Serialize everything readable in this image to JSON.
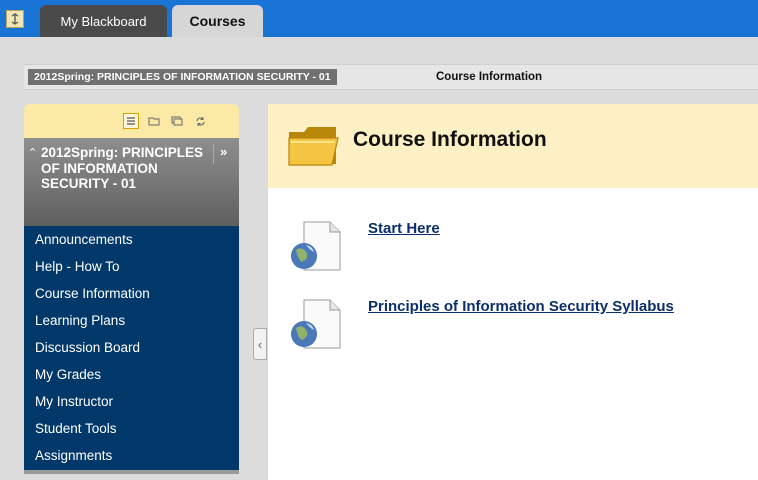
{
  "tabs": [
    {
      "label": "My Blackboard",
      "active": false
    },
    {
      "label": "Courses",
      "active": true
    }
  ],
  "breadcrumb": {
    "course": "2012Spring: PRINCIPLES OF INFORMATION SECURITY - 01",
    "current": "Course Information"
  },
  "course_menu": {
    "title": "2012Spring: PRINCIPLES OF INFORMATION SECURITY - 01",
    "items": [
      {
        "label": "Announcements"
      },
      {
        "label": "Help - How To"
      },
      {
        "label": "Course Information"
      },
      {
        "label": "Learning Plans"
      },
      {
        "label": "Discussion Board"
      },
      {
        "label": "My Grades"
      },
      {
        "label": "My Instructor"
      },
      {
        "label": "Student Tools"
      },
      {
        "label": "Assignments"
      }
    ]
  },
  "content": {
    "title": "Course Information",
    "items": [
      {
        "label": "Start Here",
        "icon": "web-link-icon"
      },
      {
        "label": "Principles of Information Security Syllabus",
        "icon": "web-link-icon"
      }
    ]
  },
  "colors": {
    "topbar": "#1a74d6",
    "menu_background": "#003869",
    "content_header": "#fdf0c4",
    "link": "#0c2f6b"
  }
}
